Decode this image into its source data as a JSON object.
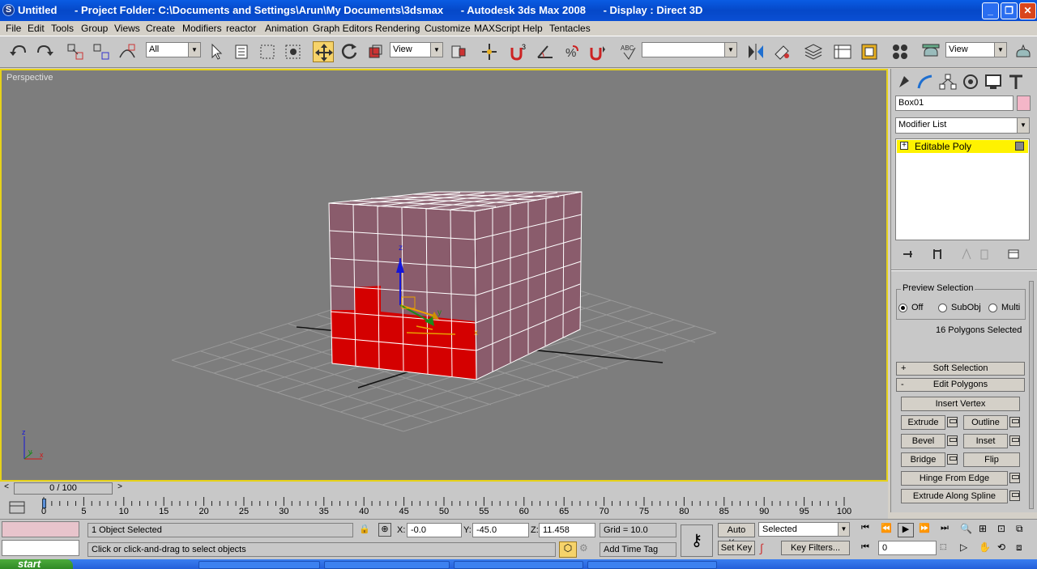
{
  "window": {
    "title": "Untitled      - Project Folder: C:\\Documents and Settings\\Arun\\My Documents\\3dsmax      - Autodesk 3ds Max 2008      - Display : Direct 3D"
  },
  "menu": [
    "File",
    "Edit",
    "Tools",
    "Group",
    "Views",
    "Create",
    "Modifiers",
    "reactor",
    "Animation",
    "Graph Editors",
    "Rendering",
    "Customize",
    "MAXScript",
    "Help",
    "Tentacles"
  ],
  "toolbar": {
    "selection_filter": "All",
    "ref_coord": "View",
    "named_sel": "",
    "render_view": "View"
  },
  "viewport": {
    "label": "Perspective"
  },
  "command_panel": {
    "object_name": "Box01",
    "object_color": "#f4b6c8",
    "modifier_list": "Modifier List",
    "stack_item": "Editable Poly",
    "preview_selection": {
      "title": "Preview Selection",
      "off": "Off",
      "subobj": "SubObj",
      "multi": "Multi",
      "selected_option": "Off"
    },
    "selection_count": "16 Polygons Selected",
    "rollouts": {
      "soft_selection": "Soft Selection",
      "edit_polygons": "Edit Polygons",
      "soft_sign": "+",
      "edit_sign": "-"
    },
    "buttons": {
      "insert_vertex": "Insert Vertex",
      "extrude": "Extrude",
      "outline": "Outline",
      "bevel": "Bevel",
      "inset": "Inset",
      "bridge": "Bridge",
      "flip": "Flip",
      "hinge": "Hinge From Edge",
      "extrude_spline": "Extrude Along Spline"
    }
  },
  "timeline": {
    "slider_label": "0 / 100",
    "ticks": [
      "0",
      "5",
      "10",
      "15",
      "20",
      "25",
      "30",
      "35",
      "40",
      "45",
      "50",
      "55",
      "60",
      "65",
      "70",
      "75",
      "80",
      "85",
      "90",
      "95",
      "100"
    ]
  },
  "status": {
    "selection_info": "1 Object Selected",
    "prompt": "Click or click-and-drag to select objects",
    "x_label": "X:",
    "x_value": "-0.0",
    "y_label": "Y:",
    "y_value": "-45.0",
    "z_label": "Z:",
    "z_value": "11.458",
    "grid": "Grid = 10.0",
    "add_time_tag": "Add Time Tag",
    "auto_key": "Auto Key",
    "set_key": "Set Key",
    "key_mode": "Selected",
    "key_filters": "Key Filters...",
    "frame": "0"
  },
  "taskbar": {
    "start": "start"
  },
  "colors": {
    "selection": "#d40000",
    "box": "#8a5c6c",
    "viewport_bg": "#7d7d7d",
    "active_border": "#e6d21a"
  }
}
